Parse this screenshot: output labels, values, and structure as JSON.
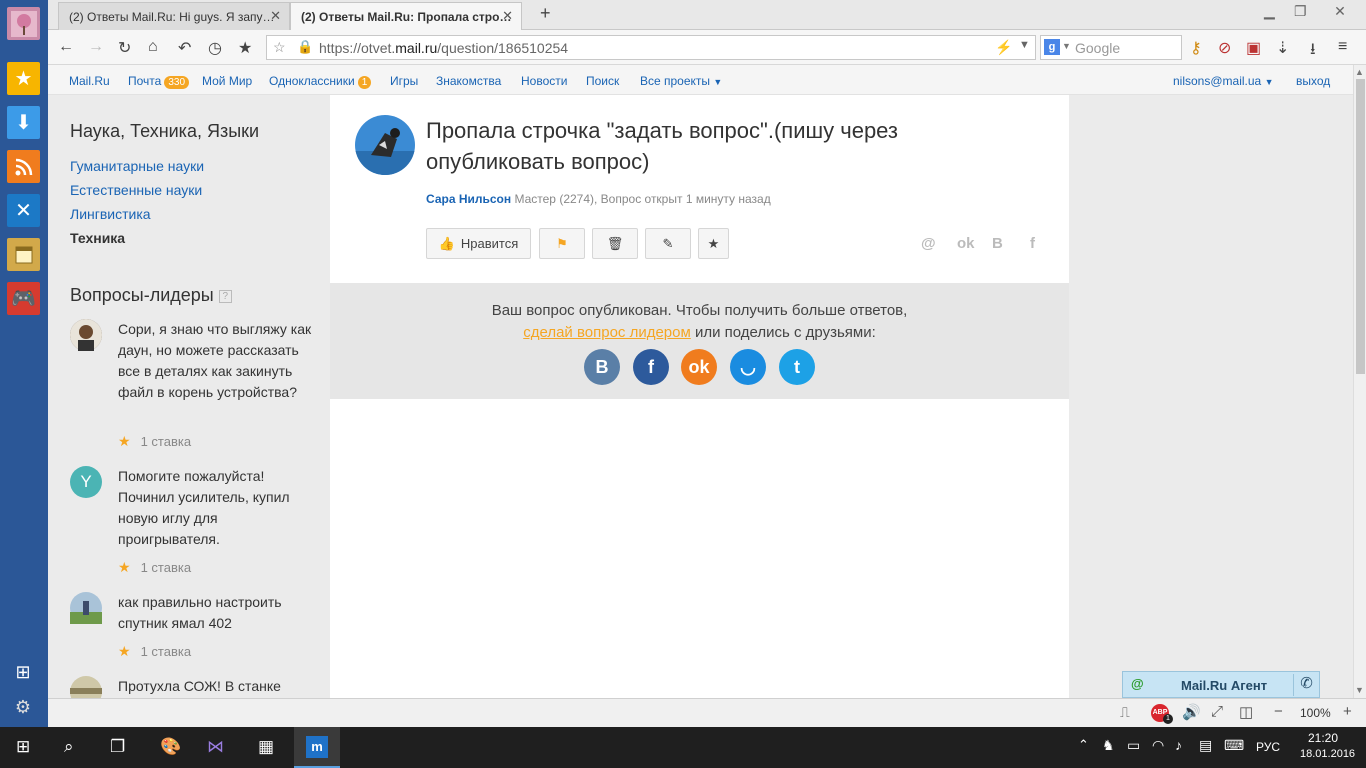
{
  "browser": {
    "tabs": [
      {
        "label": "(2) Ответы Mail.Ru: Hi guys. Я запу…",
        "active": false
      },
      {
        "label": "(2) Ответы Mail.Ru: Пропала стро…",
        "active": true
      }
    ],
    "new_tab": "+",
    "url_prefix": "https://otvet.",
    "url_domain": "mail.ru",
    "url_path": "/question/186510254",
    "search_placeholder": "Google"
  },
  "portal": {
    "links": [
      {
        "label": "Mail.Ru"
      },
      {
        "label": "Почта",
        "badge": "330"
      },
      {
        "label": "Мой Мир"
      },
      {
        "label": "Одноклассники",
        "badge": "1"
      },
      {
        "label": "Игры"
      },
      {
        "label": "Знакомства"
      },
      {
        "label": "Новости"
      },
      {
        "label": "Поиск"
      },
      {
        "label": "Все проекты"
      }
    ],
    "user": "nilsons@mail.ua",
    "logout": "выход"
  },
  "sidebar": {
    "title": "Наука, Техника, Языки",
    "categories": [
      "Гуманитарные науки",
      "Естественные науки",
      "Лингвистика",
      "Техника"
    ],
    "leaders_title": "Вопросы-лидеры",
    "help": "?",
    "leaders": [
      {
        "text": "Сори, я знаю что выгляжу как даун, но можете рассказать все в деталях как закинуть файл в корень устройства?",
        "stake": "1 ставка"
      },
      {
        "avatar_letter": "Y",
        "text": "Помогите пожалуйста! Починил усилитель, купил новую иглу для проигрывателя.",
        "stake": "1 ставка"
      },
      {
        "text": "как правильно настроить спутник ямал 402",
        "stake": "1 ставка"
      },
      {
        "text": "Протухла СОЖ! В станке"
      }
    ]
  },
  "question": {
    "title": "Пропала строчка \"задать вопрос\".(пишу через опубликовать вопрос)",
    "author": "Сара Нильсон",
    "meta": "Мастер (2274), Вопрос открыт 1 минуту назад",
    "like_label": "Нравится",
    "notice_line1": "Ваш вопрос опубликован. Чтобы получить больше ответов,",
    "notice_link": "сделай вопрос лидером",
    "notice_line2": " или поделись с друзьями:"
  },
  "agent": {
    "label": "Mail.Ru Агент"
  },
  "statusbar": {
    "zoom": "100%",
    "abp_count": "1"
  },
  "taskbar": {
    "lang": "РУС",
    "time": "21:20",
    "date": "18.01.2016"
  },
  "colors": {
    "link": "#1a64b4",
    "accent": "#f5a623",
    "sidebar": "#2b5797"
  }
}
